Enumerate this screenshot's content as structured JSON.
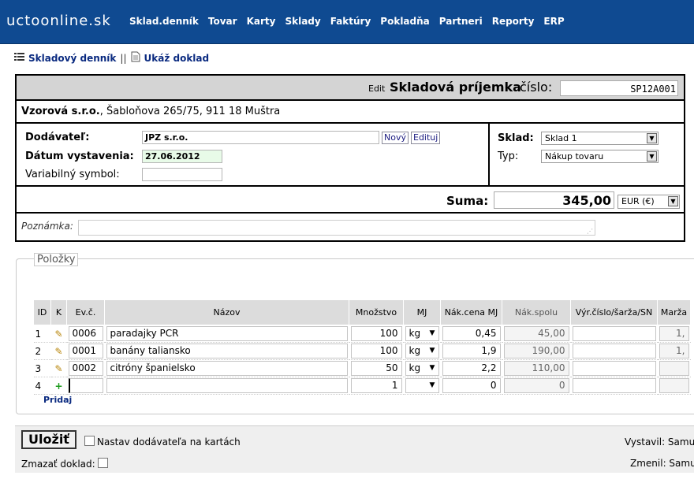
{
  "app": {
    "brand": "uctoonline.sk"
  },
  "nav": [
    "Sklad.denník",
    "Tovar",
    "Karty",
    "Sklady",
    "Faktúry",
    "Pokladňa",
    "Partneri",
    "Reporty",
    "ERP"
  ],
  "breadcrumb": {
    "journal": "Skladový denník",
    "separator": "||",
    "show_doc": "Ukáž doklad"
  },
  "header": {
    "edit": "Edit",
    "title": "Skladová príjemka",
    "number_label": "číslo:",
    "number": "SP12A001"
  },
  "company": {
    "name": "Vzorová s.r.o.",
    "address": ", Šabloňova 265/75, 911 18 Muštra"
  },
  "supplier": {
    "label": "Dodávateľ:",
    "value": "JPZ s.r.o.",
    "new_btn": "Nový",
    "edit_btn": "Edituj"
  },
  "issue_date": {
    "label": "Dátum vystavenia:",
    "value": "27.06.2012"
  },
  "var_symbol": {
    "label": "Variabilný symbol:",
    "value": ""
  },
  "warehouse": {
    "label": "Sklad:",
    "value": "Sklad 1"
  },
  "type": {
    "label": "Typ:",
    "value": "Nákup tovaru"
  },
  "sum": {
    "label": "Suma:",
    "value": "345,00",
    "currency": "EUR (€)"
  },
  "note": {
    "label": "Poznámka:",
    "value": ""
  },
  "items": {
    "legend": "Položky",
    "columns": [
      "ID",
      "K",
      "Ev.č.",
      "Názov",
      "Množstvo",
      "MJ",
      "Nák.cena MJ",
      "Nák.spolu",
      "Výr.číslo/šarža/SN",
      "Marža"
    ],
    "rows": [
      {
        "id": "1",
        "ev": "0006",
        "name": "paradajky PCR",
        "qty": "100",
        "mj": "kg",
        "price": "0,45",
        "total": "45,00",
        "sn": "",
        "margin": "1,"
      },
      {
        "id": "2",
        "ev": "0001",
        "name": "banány taliansko",
        "qty": "100",
        "mj": "kg",
        "price": "1,9",
        "total": "190,00",
        "sn": "",
        "margin": "1,"
      },
      {
        "id": "3",
        "ev": "0002",
        "name": "citróny španielsko",
        "qty": "50",
        "mj": "kg",
        "price": "2,2",
        "total": "110,00",
        "sn": "",
        "margin": ""
      },
      {
        "id": "4",
        "ev": "",
        "name": "",
        "qty": "1",
        "mj": "",
        "price": "0",
        "total": "0",
        "sn": "",
        "margin": ""
      }
    ],
    "add_link": "Pridaj"
  },
  "footer": {
    "save": "Uložiť",
    "set_supplier": "Nastav dodávateľa na kartách",
    "delete": "Zmazať doklad:",
    "issued_by": "Vystavil: Samu",
    "changed_by": "Zmenil: Samu"
  },
  "colors": {
    "nav_bg": "#0f4a91",
    "header_bg": "#d4d4d4",
    "date_bg": "#e8fbe8"
  }
}
